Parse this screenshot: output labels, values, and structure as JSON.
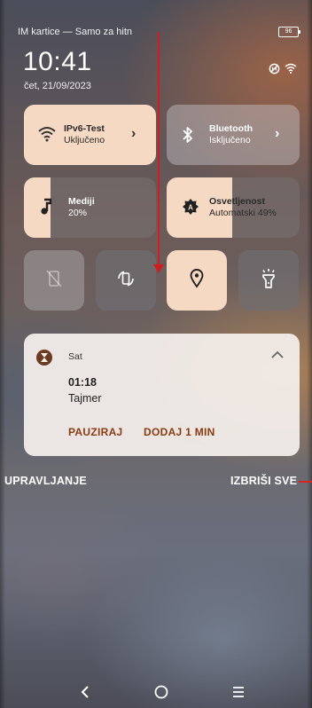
{
  "status_bar": {
    "carrier": "IM kartice — Samo za hitn",
    "battery": "96",
    "time": "10:41",
    "date": "čet, 21/09/2023",
    "icons": [
      "nfc-icon",
      "wifi-icon"
    ]
  },
  "tiles": {
    "wifi": {
      "title": "IPv6-Test",
      "status": "Uključeno",
      "icon": "wifi-icon",
      "state": "on"
    },
    "bluetooth": {
      "title": "Bluetooth",
      "status": "Isključeno",
      "icon": "bluetooth-icon",
      "state": "off"
    },
    "media": {
      "title": "Mediji",
      "value": "20%",
      "level": 0.2,
      "icon": "music-note-icon"
    },
    "brightness": {
      "title": "Osvetljenost",
      "value": "Automatski 49%",
      "level": 0.49,
      "icon": "auto-brightness-icon"
    },
    "small": [
      {
        "icon": "screen-rotation-off-icon",
        "state": "unavailable"
      },
      {
        "icon": "auto-rotate-icon",
        "state": "off"
      },
      {
        "icon": "location-icon",
        "state": "on"
      },
      {
        "icon": "flashlight-icon",
        "state": "off"
      }
    ]
  },
  "notification": {
    "app": "Sat",
    "app_icon": "hourglass-icon",
    "time": "01:18",
    "title": "Tajmer",
    "actions": [
      "PAUZIRAJ",
      "DODAJ 1 MIN"
    ]
  },
  "footer": {
    "manage": "UPRAVLJANJE",
    "clear_all": "IZBRIŠI SVE"
  },
  "nav": [
    "back-icon",
    "home-icon",
    "recents-icon"
  ],
  "colors": {
    "active_tile": "#f6d9c3",
    "action_text": "#8a3b12",
    "annotation_red": "#d11d1d"
  }
}
